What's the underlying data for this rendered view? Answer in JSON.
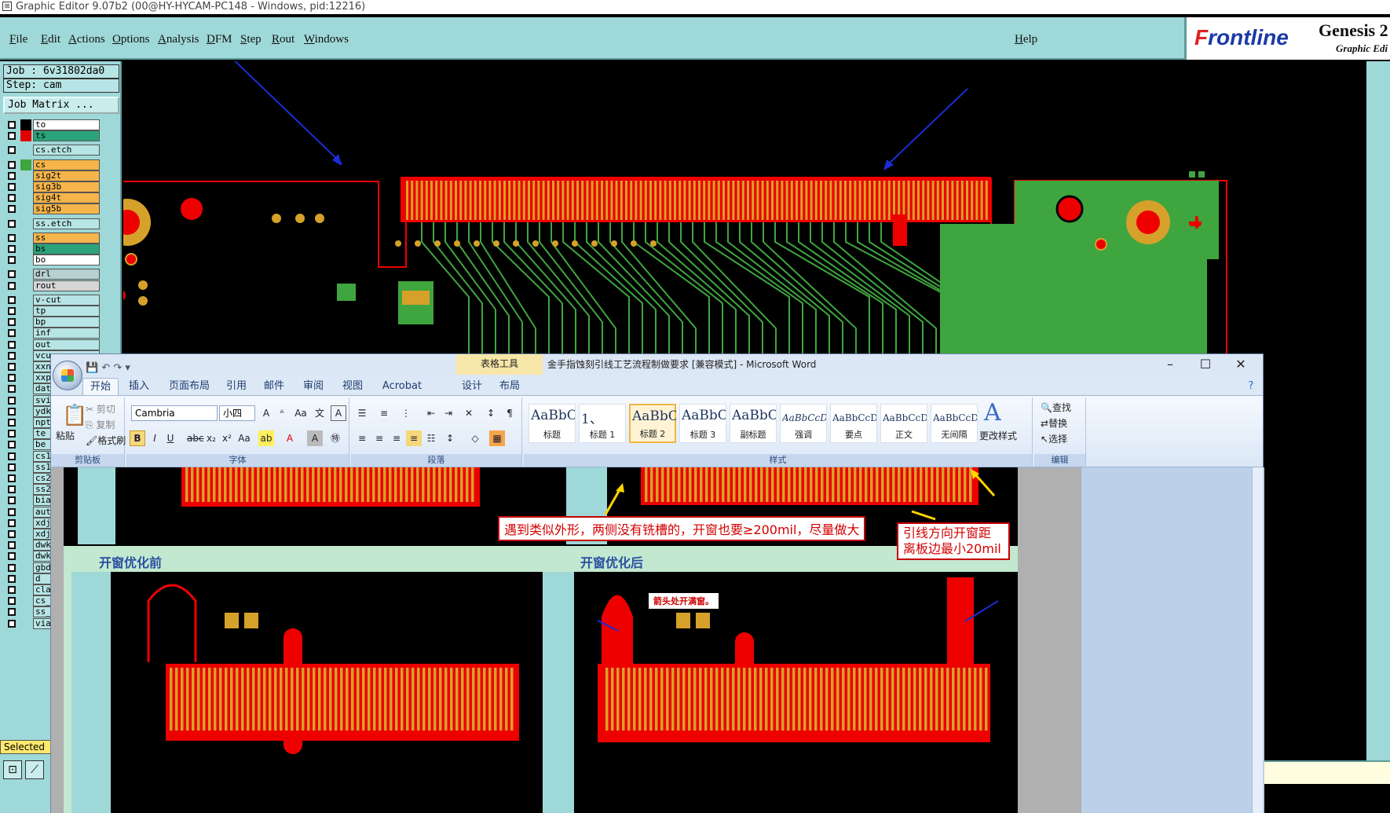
{
  "ge_window": {
    "title": "Graphic Editor 9.07b2 (00@HY-HYCAM-PC148 - Windows, pid:12216)",
    "menu": [
      "File",
      "Edit",
      "Actions",
      "Options",
      "Analysis",
      "DFM",
      "Step",
      "Rout",
      "Windows"
    ],
    "help": "Help",
    "brand": {
      "logo_f": "F",
      "logo_rest": "rontline",
      "product": "Genesis 2",
      "subtitle": "Graphic Edi"
    },
    "job": "Job : 6v31802da0",
    "step": "Step: cam",
    "job_matrix_button": "Job Matrix ...",
    "layers": [
      {
        "name": "to",
        "color": "#ffffff",
        "swatch": "#000000"
      },
      {
        "name": "ts",
        "color": "#2aa37a",
        "swatch": "#e00000"
      },
      {
        "name": "cs.etch",
        "color": "#b7e4e4",
        "swatch": ""
      },
      {
        "name": "cs",
        "color": "#f5b54a",
        "swatch": "#3fa53f"
      },
      {
        "name": "sig2t",
        "color": "#f5b54a",
        "swatch": ""
      },
      {
        "name": "sig3b",
        "color": "#f5b54a",
        "swatch": ""
      },
      {
        "name": "sig4t",
        "color": "#f5b54a",
        "swatch": ""
      },
      {
        "name": "sig5b",
        "color": "#f5b54a",
        "swatch": ""
      },
      {
        "name": "ss.etch",
        "color": "#b7e4e4",
        "swatch": ""
      },
      {
        "name": "ss",
        "color": "#f5b54a",
        "swatch": ""
      },
      {
        "name": "bs",
        "color": "#2aa37a",
        "swatch": ""
      },
      {
        "name": "bo",
        "color": "#ffffff",
        "swatch": ""
      },
      {
        "name": "drl",
        "color": "#b7d0d0",
        "swatch": ""
      },
      {
        "name": "rout",
        "color": "#d6d6d6",
        "swatch": ""
      },
      {
        "name": "v-cut",
        "color": "#b7e4e4",
        "swatch": ""
      },
      {
        "name": "tp",
        "color": "#b7e4e4",
        "swatch": ""
      },
      {
        "name": "bp",
        "color": "#b7e4e4",
        "swatch": ""
      },
      {
        "name": "inf",
        "color": "#b7e4e4",
        "swatch": ""
      },
      {
        "name": "out",
        "color": "#b7e4e4",
        "swatch": ""
      },
      {
        "name": "vcu",
        "color": "#b7e4e4",
        "swatch": ""
      },
      {
        "name": "xxn",
        "color": "#b7e4e4",
        "swatch": ""
      },
      {
        "name": "xxp",
        "color": "#b7e4e4",
        "swatch": ""
      },
      {
        "name": "dat",
        "color": "#b7e4e4",
        "swatch": ""
      },
      {
        "name": "svi",
        "color": "#b7e4e4",
        "swatch": ""
      },
      {
        "name": "ydk",
        "color": "#b7e4e4",
        "swatch": ""
      },
      {
        "name": "npt",
        "color": "#b7e4e4",
        "swatch": ""
      },
      {
        "name": "te",
        "color": "#b7e4e4",
        "swatch": ""
      },
      {
        "name": "be",
        "color": "#b7e4e4",
        "swatch": ""
      },
      {
        "name": "cs1",
        "color": "#b7e4e4",
        "swatch": ""
      },
      {
        "name": "ss1",
        "color": "#b7e4e4",
        "swatch": ""
      },
      {
        "name": "cs2",
        "color": "#b7e4e4",
        "swatch": ""
      },
      {
        "name": "ss2",
        "color": "#b7e4e4",
        "swatch": ""
      },
      {
        "name": "bia",
        "color": "#b7e4e4",
        "swatch": ""
      },
      {
        "name": "aut",
        "color": "#b7e4e4",
        "swatch": ""
      },
      {
        "name": "xdj",
        "color": "#b7e4e4",
        "swatch": ""
      },
      {
        "name": "xdj",
        "color": "#b7e4e4",
        "swatch": ""
      },
      {
        "name": "dwk",
        "color": "#b7e4e4",
        "swatch": ""
      },
      {
        "name": "dwk",
        "color": "#b7e4e4",
        "swatch": ""
      },
      {
        "name": "gbd",
        "color": "#b7e4e4",
        "swatch": ""
      },
      {
        "name": "d",
        "color": "#b7e4e4",
        "swatch": ""
      },
      {
        "name": "cla",
        "color": "#b7e4e4",
        "swatch": ""
      },
      {
        "name": "cs_",
        "color": "#b7e4e4",
        "swatch": ""
      },
      {
        "name": "ss_",
        "color": "#b7e4e4",
        "swatch": ""
      },
      {
        "name": "via",
        "color": "#b7e4e4",
        "swatch": ""
      }
    ],
    "selected": "Selected"
  },
  "word_window": {
    "title": "金手指蚀刻引线工艺流程制做要求 [兼容模式] - Microsoft Word",
    "context_tab": "表格工具",
    "tabs": [
      "开始",
      "插入",
      "页面布局",
      "引用",
      "邮件",
      "审阅",
      "视图",
      "Acrobat",
      "设计",
      "布局"
    ],
    "active_tab": "开始",
    "clipboard": {
      "paste": "粘贴",
      "cut": "剪切",
      "copy": "复制",
      "format_painter": "格式刷",
      "label": "剪贴板"
    },
    "font": {
      "name": "Cambria",
      "size": "小四",
      "label": "字体"
    },
    "paragraph_label": "段落",
    "styles": [
      {
        "preview": "AaBbC",
        "label": "标题"
      },
      {
        "preview": "1、",
        "label": "标题 1"
      },
      {
        "preview": "AaBbC",
        "label": "标题 2"
      },
      {
        "preview": "AaBbC",
        "label": "标题 3"
      },
      {
        "preview": "AaBbC",
        "label": "副标题"
      },
      {
        "preview": "AaBbCcDd",
        "label": "强调"
      },
      {
        "preview": "AaBbCcD",
        "label": "要点"
      },
      {
        "preview": "AaBbCcDd",
        "label": "正文"
      },
      {
        "preview": "AaBbCcDd",
        "label": "无间隔"
      }
    ],
    "change_styles": "更改样式",
    "styles_label": "样式",
    "editing": {
      "find": "查找",
      "replace": "替换",
      "select": "选择",
      "label": "编辑"
    },
    "document": {
      "callout_1": "遇到类似外形，两侧没有铣槽的，开窗也要≥200mil，尽量做大",
      "callout_2_line1": "引线方向开窗距",
      "callout_2_line2": "离板边最小20mil",
      "heading_before": "开窗优化前",
      "heading_after": "开窗优化后",
      "note_arrow": "箭头处开满窗。"
    }
  }
}
